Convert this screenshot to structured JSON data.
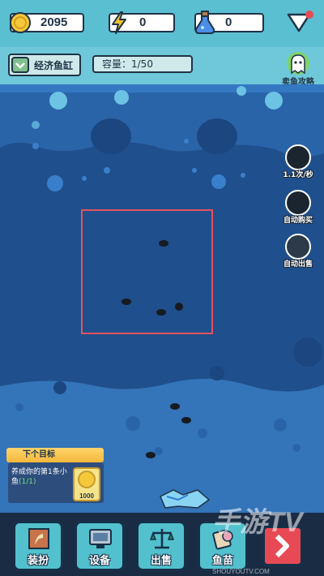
{
  "currency": {
    "coins": "2095",
    "energy": "0",
    "potion": "0",
    "colors": {
      "coin": "#f5c83a",
      "energy": "#f2c230",
      "potion": "#4b8ee6"
    }
  },
  "tank": {
    "name": "经济鱼缸",
    "capacity": "容量：1/50"
  },
  "guide": {
    "label": "卖鱼攻略"
  },
  "side_buttons": [
    {
      "label": "1.1次/秒",
      "icon": "auto-feed-icon"
    },
    {
      "label": "自动购买",
      "icon": "auto-buy-icon"
    },
    {
      "label": "自动出售",
      "icon": "auto-sell-icon"
    }
  ],
  "goal": {
    "banner": "下个目标",
    "desc_main": "养成你的第1条小鱼",
    "desc_progress": "(1/1)",
    "reward": "1000"
  },
  "bottom_nav": [
    {
      "label": "装扮",
      "icon": "dress-up-icon"
    },
    {
      "label": "设备",
      "icon": "equipment-icon"
    },
    {
      "label": "出售",
      "icon": "sell-scale-icon"
    },
    {
      "label": "鱼苗",
      "icon": "fry-icon"
    }
  ],
  "watermark": {
    "main": "手游TV",
    "sub": "SHOUYOUTV.COM"
  }
}
